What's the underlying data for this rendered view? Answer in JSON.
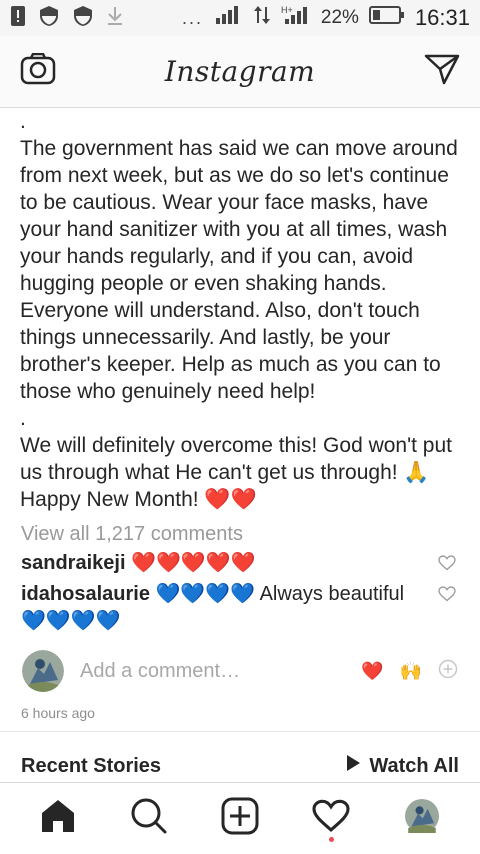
{
  "status_bar": {
    "dots": "...",
    "battery_percent": "22%",
    "time": "16:31"
  },
  "header": {
    "logo": "Instagram",
    "icons": {
      "left": "camera-icon",
      "right": "direct-message-icon"
    }
  },
  "post": {
    "caption": [
      ".",
      "The government has said we can move around from next week, but as we do so let's continue to be cautious. Wear your face masks, have your hand sanitizer with you at all times, wash your hands regularly, and if you can, avoid hugging people or even shaking hands. Everyone will understand. Also, don't touch things unnecessarily. And lastly, be your brother's keeper. Help as much as you can to those who genuinely need help!",
      ".",
      "We will definitely overcome this! God won't put us through what He can't get us through! 🙏 Happy New Month! ❤️❤️"
    ],
    "view_all_comments": "View all 1,217 comments",
    "comments": [
      {
        "user": "sandraikeji",
        "text": "❤️❤️❤️❤️❤️"
      },
      {
        "user": "idahosalaurie",
        "text": "💙💙💙💙 Always beautiful 💙💙💙💙"
      }
    ],
    "add_comment_placeholder": "Add a comment…",
    "quick_reactions": [
      "❤️",
      "🙌"
    ],
    "timestamp": "6 hours ago"
  },
  "recent_stories": {
    "title": "Recent Stories",
    "watch_all": "Watch All"
  },
  "bottom_nav": {
    "items": [
      "home-icon",
      "search-icon",
      "new-post-icon",
      "activity-icon",
      "profile-avatar"
    ],
    "notification_color": "#ed4956"
  },
  "colors": {
    "text": "#262626",
    "muted": "#999999",
    "heart_red": "#ed4956",
    "blue_heart": "#3b94d9"
  }
}
